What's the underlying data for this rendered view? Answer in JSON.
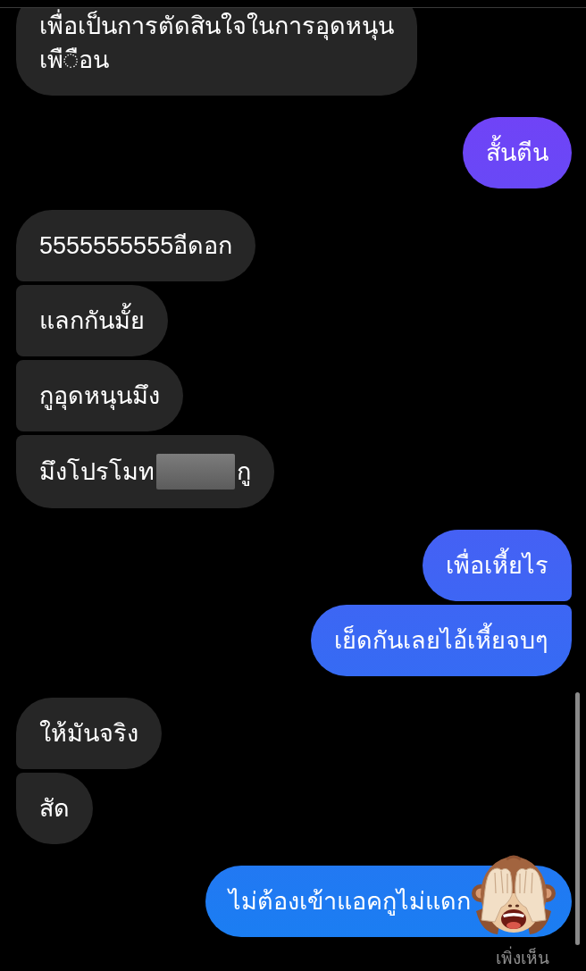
{
  "messages": [
    {
      "kind": "received",
      "text": "เพื่อเป็นการตัดสินใจในการอุดหนุน\nเพื◌ือน"
    },
    {
      "kind": "sent",
      "text": "สั้นตีน"
    },
    {
      "kind": "received",
      "text": "5555555555อีดอก"
    },
    {
      "kind": "received",
      "text": "แลกกันมั้ย"
    },
    {
      "kind": "received",
      "text": "กูอุดหนุนมึง"
    },
    {
      "kind": "received",
      "segments": [
        {
          "kind": "text",
          "text": "มึงโปรโมท"
        },
        {
          "kind": "redaction"
        },
        {
          "kind": "text",
          "text": "กู"
        }
      ]
    },
    {
      "kind": "sent",
      "text": "เพื่อเหี้ยไร"
    },
    {
      "kind": "sent",
      "text": "เย็ดกันเลยไอ้เหี้ยจบๆ"
    },
    {
      "kind": "received",
      "text": "ให้มันจริง"
    },
    {
      "kind": "received",
      "text": "สัด"
    },
    {
      "kind": "sent",
      "text": "ไม่ต้องเข้าแอคกูไม่แดก",
      "emoji": true
    }
  ],
  "seen_status": "เพิ่งเห็น"
}
